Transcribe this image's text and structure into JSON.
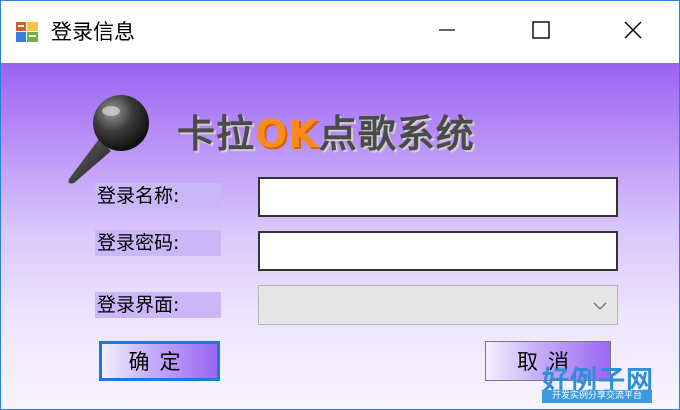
{
  "window": {
    "title": "登录信息",
    "title_icon": "app-form-icon",
    "controls": {
      "minimize": "minimize-icon",
      "maximize": "maximize-icon",
      "close": "close-icon"
    }
  },
  "banner": {
    "logo_prefix": "卡拉",
    "logo_ok": "OK",
    "logo_suffix": "点歌系统",
    "icon": "microphone-icon"
  },
  "form": {
    "username_label": "登录名称:",
    "username_value": "",
    "password_label": "登录密码:",
    "password_value": "",
    "interface_label": "登录界面:",
    "interface_selected": ""
  },
  "buttons": {
    "ok_label": "确定",
    "cancel_label": "取消"
  },
  "watermark": {
    "title": "好例子网",
    "subtitle": "开发实例分享交流平台"
  },
  "colors": {
    "accent": "#9b66f3",
    "focus_border": "#1e78d7",
    "logo_ok": "#ff8a1c",
    "label_bg": "#c9b7f7"
  }
}
